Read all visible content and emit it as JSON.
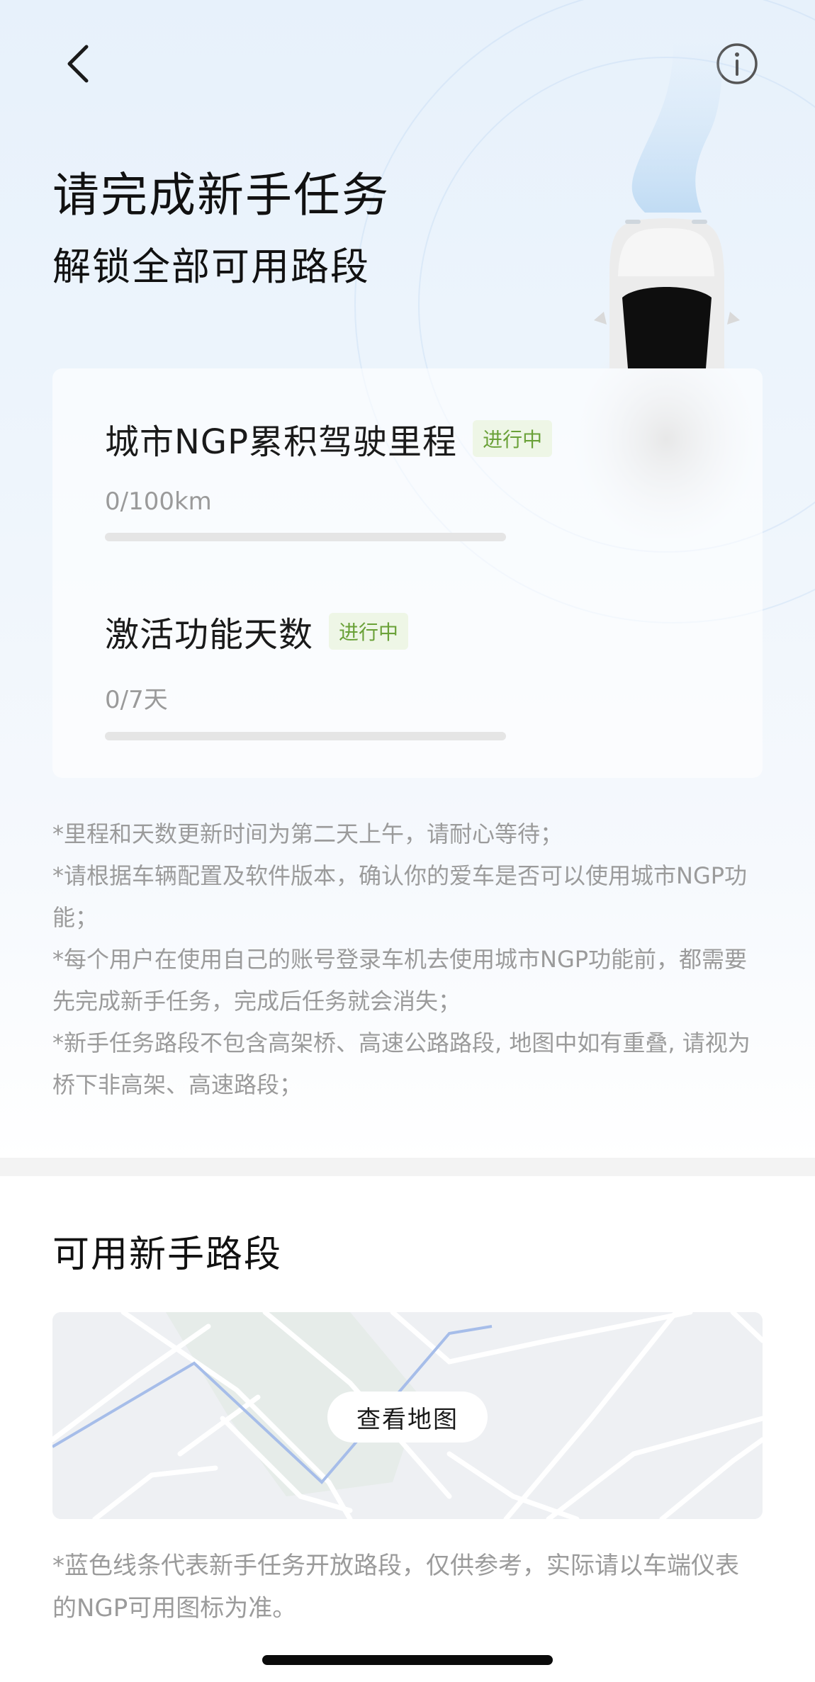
{
  "header": {
    "back_icon": "chevron-left-icon",
    "info_icon": "info-circle-icon"
  },
  "hero": {
    "title": "请完成新手任务",
    "subtitle": "解锁全部可用路段"
  },
  "tasks": [
    {
      "title": "城市NGP累积驾驶里程",
      "status": "进行中",
      "progress_text": "0/100km",
      "progress": 0
    },
    {
      "title": "激活功能天数",
      "status": "进行中",
      "progress_text": "0/7天",
      "progress": 0
    }
  ],
  "notes": [
    "*里程和天数更新时间为第二天上午，请耐心等待；",
    "*请根据车辆配置及软件版本，确认你的爱车是否可以使用城市NGP功能；",
    "*每个用户在使用自己的账号登录车机去使用城市NGP功能前，都需要先完成新手任务，完成后任务就会消失；",
    "*新手任务路段不包含高架桥、高速公路路段, 地图中如有重叠, 请视为桥下非高架、高速路段；"
  ],
  "routes_section": {
    "title": "可用新手路段",
    "map_button_label": "查看地图",
    "footnote": "*蓝色线条代表新手任务开放路段，仅供参考，实际请以车端仪表的NGP可用图标为准。"
  },
  "colors": {
    "badge_text": "#6aa138",
    "badge_bg": "#eef6e6",
    "route_line": "#9bb3e6",
    "hero_bg": "#e7f1fb"
  }
}
